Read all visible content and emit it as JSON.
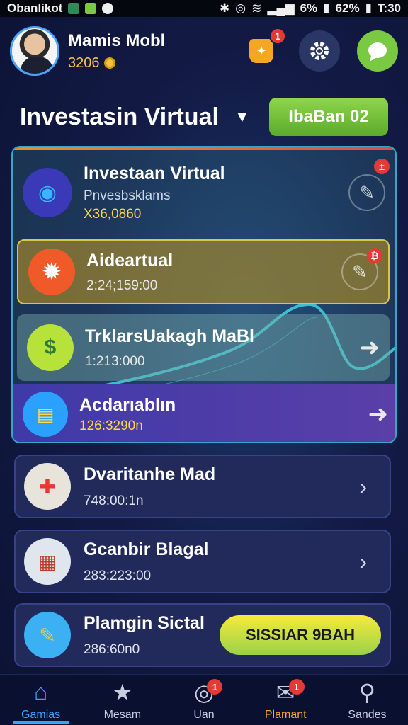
{
  "status_bar": {
    "carrier": "Obanlikot",
    "battery_left": "6%",
    "battery_right": "62%",
    "time": "T:30"
  },
  "user": {
    "name": "Mamis Mobl",
    "points": "3206"
  },
  "header": {
    "notif_count": "1"
  },
  "title": {
    "text": "Investasin Virtual",
    "button": "IbaBan 02"
  },
  "group_cards": [
    {
      "title": "Investaan Virtual",
      "subtitle": "Pnvesbsklams",
      "value": "X36,0860",
      "corner": "±"
    },
    {
      "title": "Aideartual",
      "value": "2:24;159:00",
      "corner": "₿"
    },
    {
      "title": "TrklarsUakagh MaBl",
      "value": "1:213:000"
    },
    {
      "title": "Acdarıablın",
      "value": "126:3290n"
    }
  ],
  "bottom_cards": [
    {
      "title": "Dvaritanhe Mad",
      "value": "748:00:1n"
    },
    {
      "title": "Gcanbir Blagal",
      "value": "283:223:00"
    },
    {
      "title": "Plamgin Sictal",
      "value": "286:60n0",
      "button": "SISSIAR 9BAH"
    }
  ],
  "bottom_nav": [
    {
      "label": "Gamias",
      "icon": "home-icon",
      "active": true
    },
    {
      "label": "Mesam",
      "icon": "star-icon"
    },
    {
      "label": "Uan",
      "icon": "camera-icon",
      "badge": "1"
    },
    {
      "label": "Plamant",
      "icon": "mail-icon",
      "badge": "1"
    },
    {
      "label": "Sandes",
      "icon": "search-icon"
    }
  ]
}
